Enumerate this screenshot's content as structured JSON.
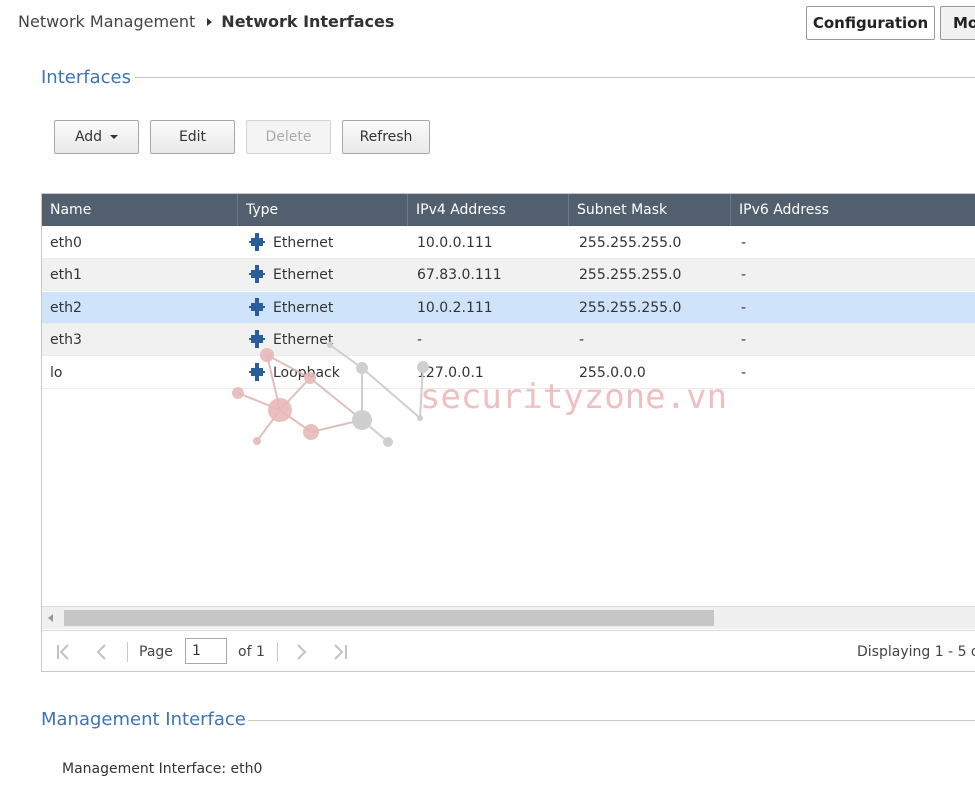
{
  "breadcrumb": {
    "parent": "Network Management",
    "current": "Network Interfaces"
  },
  "header_buttons": {
    "configuration": "Configuration",
    "monitor": "Mo"
  },
  "interfaces_section": {
    "title": "Interfaces"
  },
  "toolbar": {
    "add": "Add",
    "edit": "Edit",
    "delete": "Delete",
    "refresh": "Refresh"
  },
  "grid": {
    "columns": [
      "Name",
      "Type",
      "IPv4 Address",
      "Subnet Mask",
      "IPv6 Address"
    ],
    "rows": [
      {
        "name": "eth0",
        "type": "Ethernet",
        "ipv4": "10.0.0.111",
        "mask": "255.255.255.0",
        "ipv6": "-"
      },
      {
        "name": "eth1",
        "type": "Ethernet",
        "ipv4": "67.83.0.111",
        "mask": "255.255.255.0",
        "ipv6": "-"
      },
      {
        "name": "eth2",
        "type": "Ethernet",
        "ipv4": "10.0.2.111",
        "mask": "255.255.255.0",
        "ipv6": "-"
      },
      {
        "name": "eth3",
        "type": "Ethernet",
        "ipv4": "-",
        "mask": "-",
        "ipv6": "-"
      },
      {
        "name": "lo",
        "type": "Loopback",
        "ipv4": "127.0.0.1",
        "mask": "255.0.0.0",
        "ipv6": "-"
      }
    ],
    "selected_row": "eth2",
    "type_icon": "network-port-icon"
  },
  "pager": {
    "page_label": "Page",
    "page_value": "1",
    "of_label": "of 1",
    "displaying": "Displaying 1 - 5 o"
  },
  "management_section": {
    "title": "Management Interface",
    "text": "Management Interface: eth0"
  },
  "watermark": {
    "text": "securityzone.vn"
  },
  "colors": {
    "header_bg": "#515f6f",
    "accent": "#3d74b5",
    "selected_row": "#cfe4fb",
    "icon": "#2a5d9a"
  }
}
